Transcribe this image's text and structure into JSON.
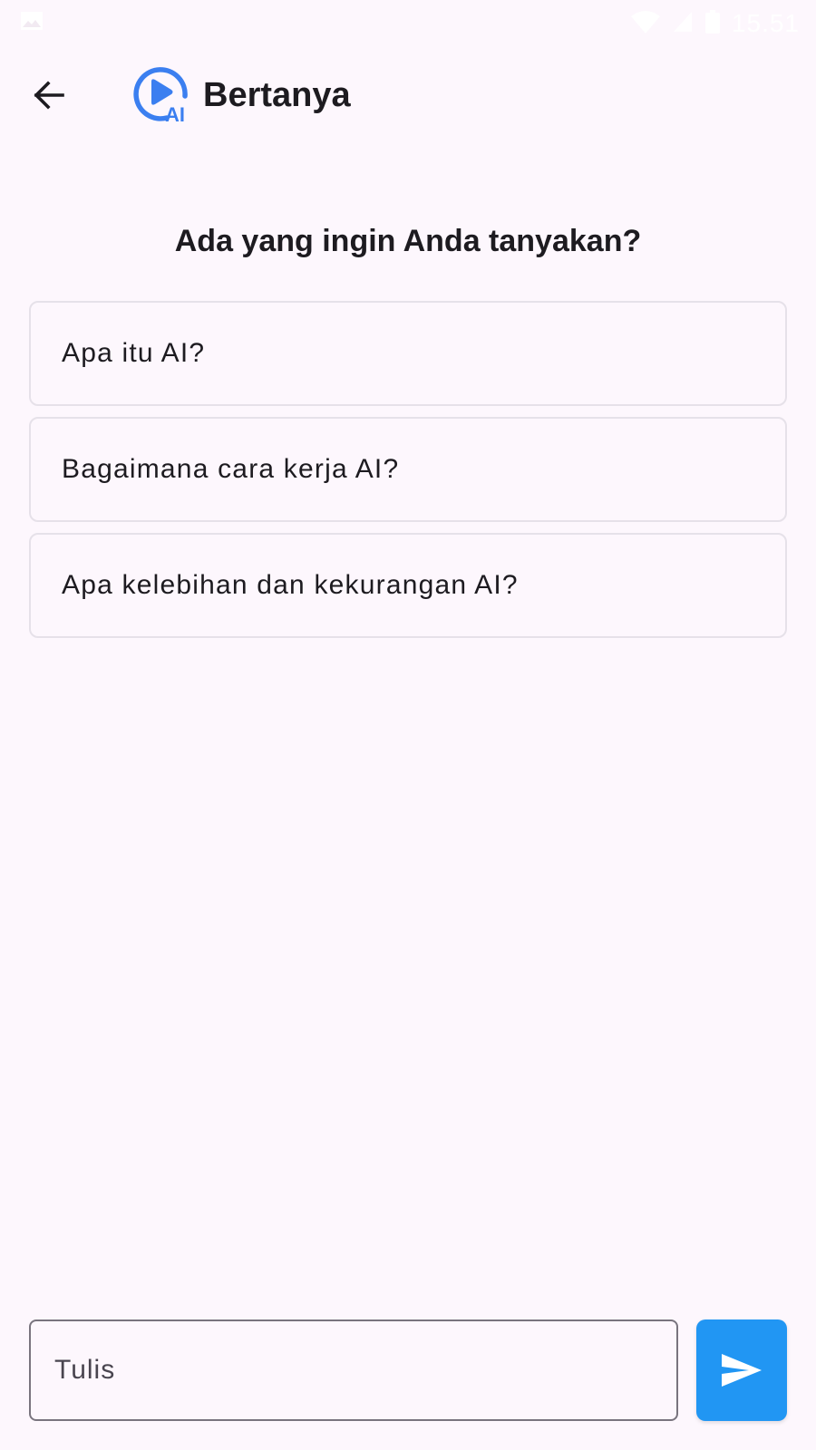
{
  "status_bar": {
    "time": "15.51",
    "icons": [
      "image-icon",
      "wifi-icon",
      "signal-icon",
      "battery-icon"
    ]
  },
  "app_bar": {
    "title": "Bertanya",
    "back_icon": "arrow-left-icon",
    "logo_icon": "play-ai-logo-icon",
    "logo_text": "AI"
  },
  "main": {
    "heading": "Ada yang ingin Anda tanyakan?",
    "suggestions": [
      {
        "label": "Apa itu AI?"
      },
      {
        "label": "Bagaimana cara kerja AI?"
      },
      {
        "label": "Apa kelebihan dan kekurangan AI?"
      }
    ]
  },
  "composer": {
    "placeholder": "Tulis",
    "value": "",
    "send_icon": "send-icon"
  },
  "colors": {
    "background": "#fdf7fd",
    "accent": "#2196f3",
    "logo_blue": "#3b7ff0",
    "text": "#1d1b20",
    "card_border": "#e6e1e9",
    "field_border": "#79747e"
  }
}
